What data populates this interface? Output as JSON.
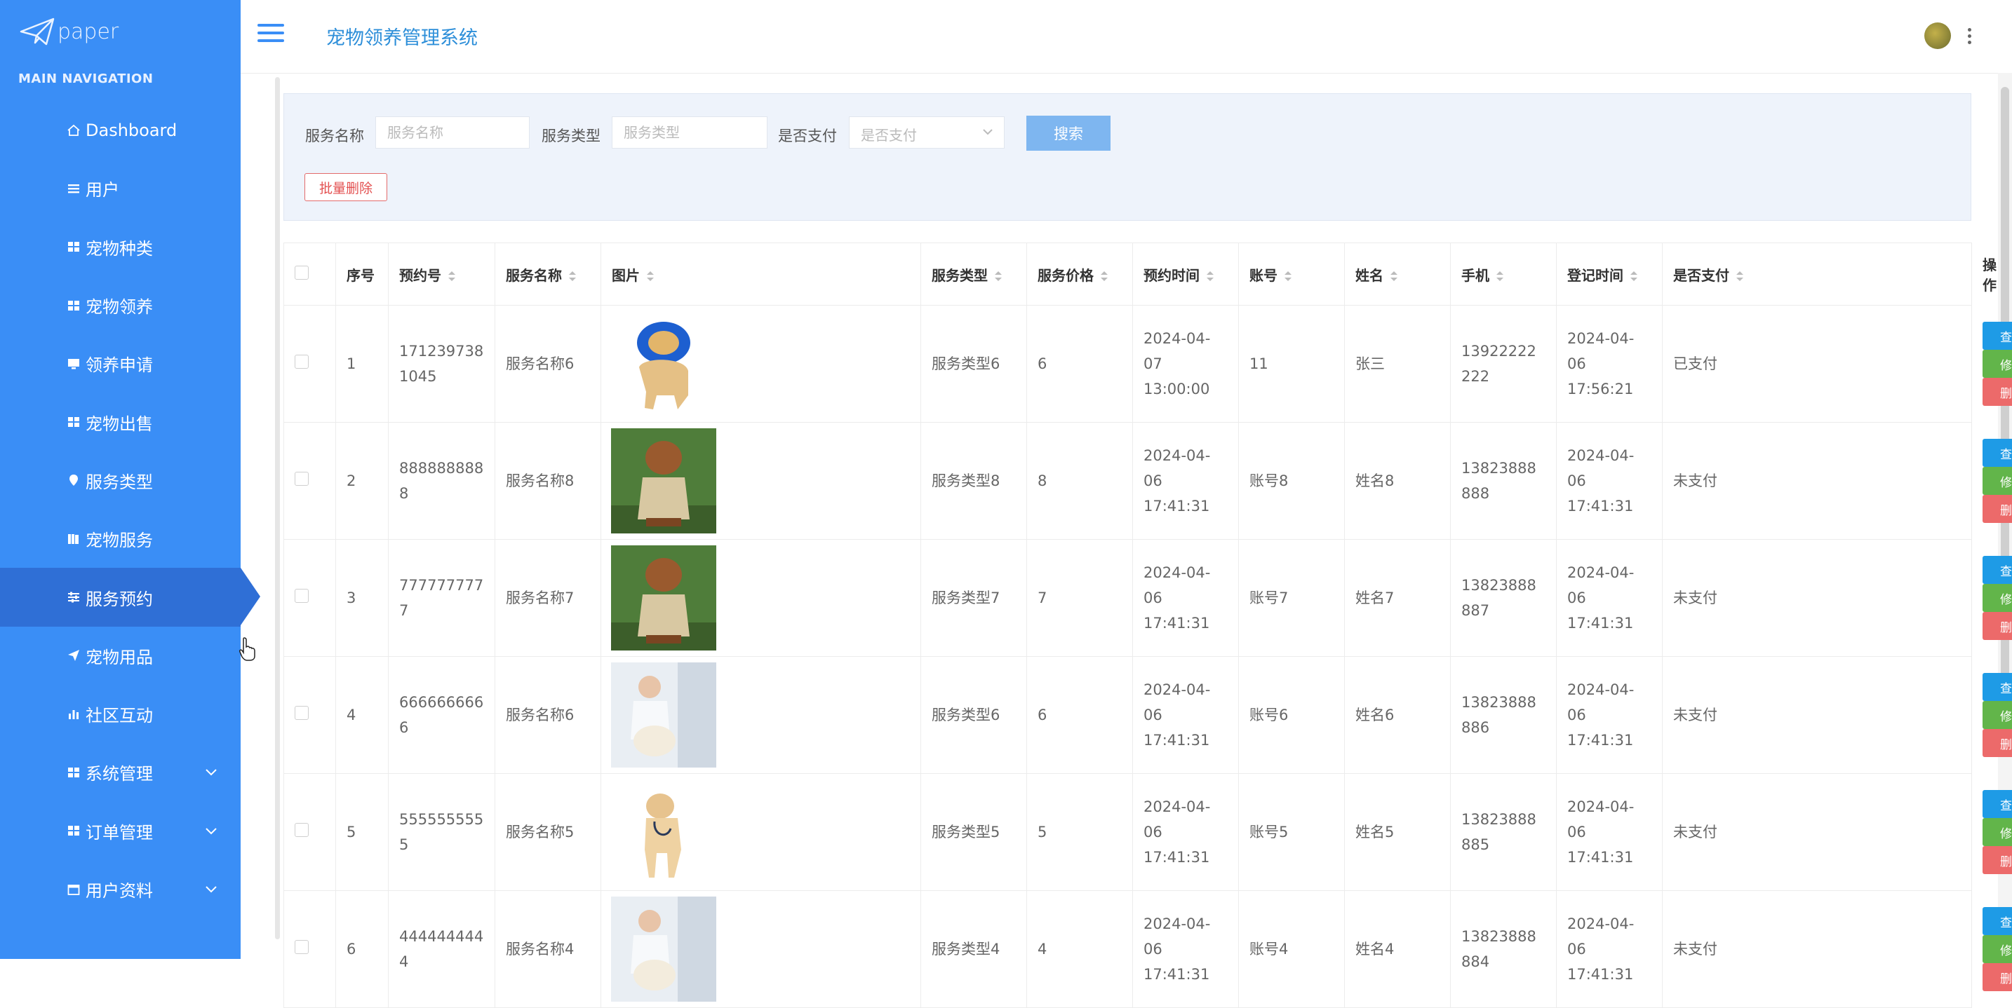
{
  "brand": {
    "name": "paper"
  },
  "nav": {
    "header": "MAIN NAVIGATION",
    "items": [
      {
        "label": "Dashboard",
        "icon": "home-icon"
      },
      {
        "label": "用户",
        "icon": "list-icon"
      },
      {
        "label": "宠物种类",
        "icon": "grid-icon"
      },
      {
        "label": "宠物领养",
        "icon": "grid-icon"
      },
      {
        "label": "领养申请",
        "icon": "monitor-icon"
      },
      {
        "label": "宠物出售",
        "icon": "grid-icon"
      },
      {
        "label": "服务类型",
        "icon": "location-pin-icon"
      },
      {
        "label": "宠物服务",
        "icon": "book-icon"
      },
      {
        "label": "服务预约",
        "icon": "sliders-icon",
        "active": true
      },
      {
        "label": "宠物用品",
        "icon": "paper-plane-icon"
      },
      {
        "label": "社区互动",
        "icon": "bar-chart-icon"
      },
      {
        "label": "系统管理",
        "icon": "grid-icon",
        "expandable": true
      },
      {
        "label": "订单管理",
        "icon": "grid-icon",
        "expandable": true
      },
      {
        "label": "用户资料",
        "icon": "calendar-icon",
        "expandable": true
      }
    ]
  },
  "topbar": {
    "title": "宠物领养管理系统"
  },
  "search": {
    "service_name_label": "服务名称",
    "service_name_placeholder": "服务名称",
    "service_type_label": "服务类型",
    "service_type_placeholder": "服务类型",
    "paid_label": "是否支付",
    "paid_placeholder": "是否支付",
    "search_button": "搜索",
    "batch_delete_button": "批量删除"
  },
  "table": {
    "columns": [
      "序号",
      "预约号",
      "服务名称",
      "图片",
      "服务类型",
      "服务价格",
      "预约时间",
      "账号",
      "姓名",
      "手机",
      "登记时间",
      "是否支付",
      "操作"
    ],
    "actions": {
      "view": "查看",
      "edit": "修改",
      "delete": "删除"
    },
    "rows": [
      {
        "idx": "1",
        "booking_no": "1712397381045",
        "service_name": "服务名称6",
        "image": "dog-cone",
        "service_type": "服务类型6",
        "price": "6",
        "booking_time": "2024-04-07 13:00:00",
        "account": "11",
        "name": "张三",
        "phone": "13922222222",
        "reg_time": "2024-04-06 17:56:21",
        "paid": "已支付"
      },
      {
        "idx": "2",
        "booking_no": "8888888888",
        "service_name": "服务名称8",
        "image": "dog-coat",
        "service_type": "服务类型8",
        "price": "8",
        "booking_time": "2024-04-06 17:41:31",
        "account": "账号8",
        "name": "姓名8",
        "phone": "13823888888",
        "reg_time": "2024-04-06 17:41:31",
        "paid": "未支付"
      },
      {
        "idx": "3",
        "booking_no": "7777777777",
        "service_name": "服务名称7",
        "image": "dog-coat",
        "service_type": "服务类型7",
        "price": "7",
        "booking_time": "2024-04-06 17:41:31",
        "account": "账号7",
        "name": "姓名7",
        "phone": "13823888887",
        "reg_time": "2024-04-06 17:41:31",
        "paid": "未支付"
      },
      {
        "idx": "4",
        "booking_no": "6666666666",
        "service_name": "服务名称6",
        "image": "dog-vet",
        "service_type": "服务类型6",
        "price": "6",
        "booking_time": "2024-04-06 17:41:31",
        "account": "账号6",
        "name": "姓名6",
        "phone": "13823888886",
        "reg_time": "2024-04-06 17:41:31",
        "paid": "未支付"
      },
      {
        "idx": "5",
        "booking_no": "5555555555",
        "service_name": "服务名称5",
        "image": "dog-stetho",
        "service_type": "服务类型5",
        "price": "5",
        "booking_time": "2024-04-06 17:41:31",
        "account": "账号5",
        "name": "姓名5",
        "phone": "13823888885",
        "reg_time": "2024-04-06 17:41:31",
        "paid": "未支付"
      },
      {
        "idx": "6",
        "booking_no": "4444444444",
        "service_name": "服务名称4",
        "image": "dog-vet",
        "service_type": "服务类型4",
        "price": "4",
        "booking_time": "2024-04-06 17:41:31",
        "account": "账号4",
        "name": "姓名4",
        "phone": "13823888884",
        "reg_time": "2024-04-06 17:41:31",
        "paid": "未支付"
      }
    ]
  },
  "colors": {
    "sidebar": "#3a8ef6",
    "active": "#2f6fd6",
    "view": "#1e9be6",
    "edit": "#62b54a",
    "delete": "#ec6a6a",
    "title": "#2e8fd9"
  }
}
